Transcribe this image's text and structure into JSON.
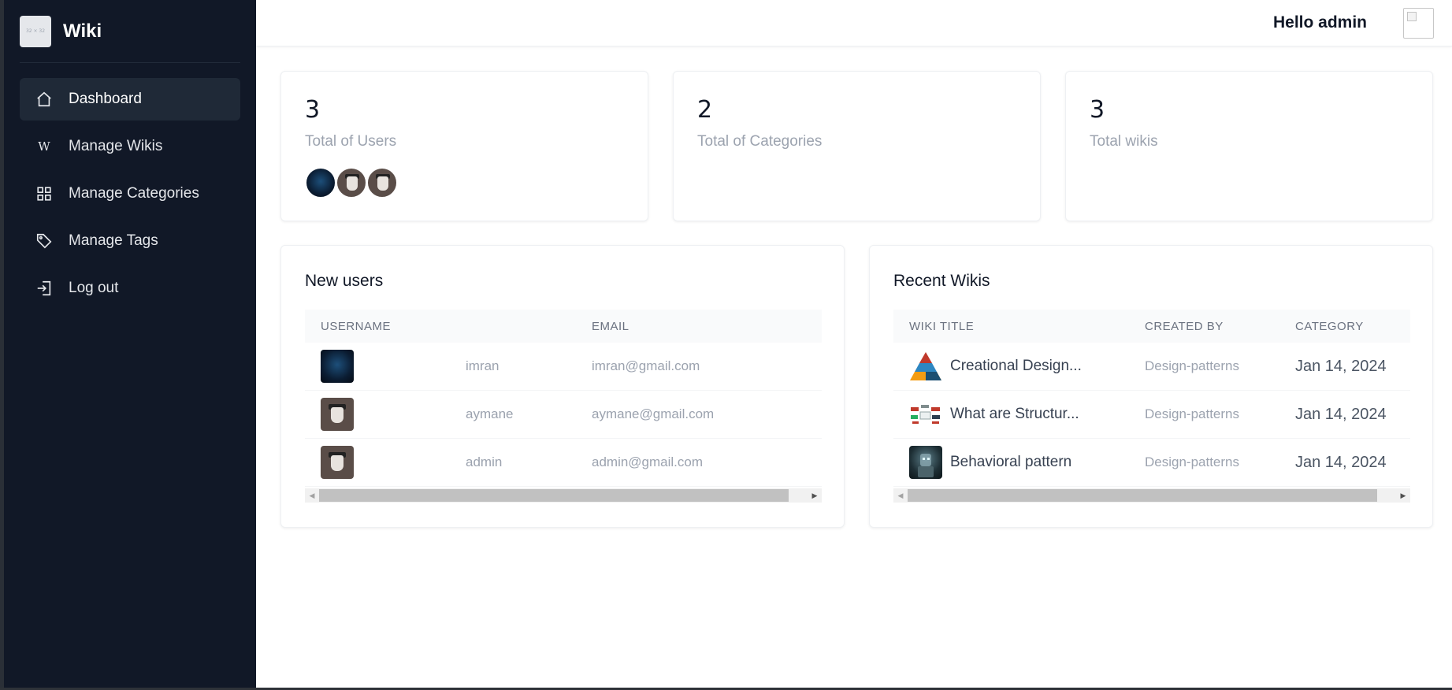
{
  "brand": {
    "logo_text": "32 × 32",
    "name": "Wiki"
  },
  "sidebar": {
    "items": [
      {
        "label": "Dashboard",
        "icon": "home-icon",
        "active": true
      },
      {
        "label": "Manage Wikis",
        "icon": "wiki-w-icon",
        "active": false
      },
      {
        "label": "Manage Categories",
        "icon": "grid-icon",
        "active": false
      },
      {
        "label": "Manage Tags",
        "icon": "tag-icon",
        "active": false
      },
      {
        "label": "Log out",
        "icon": "logout-icon",
        "active": false
      }
    ]
  },
  "header": {
    "greeting": "Hello admin",
    "avatar_icon": "broken-image-icon"
  },
  "stats": [
    {
      "value": "3",
      "label": "Total of Users"
    },
    {
      "value": "2",
      "label": "Total of Categories"
    },
    {
      "value": "3",
      "label": "Total wikis"
    }
  ],
  "new_users": {
    "title": "New users",
    "columns": [
      "USERNAME",
      "EMAIL"
    ],
    "rows": [
      {
        "username": "imran",
        "email": "imran@gmail.com",
        "avatar": "pattern-avatar"
      },
      {
        "username": "aymane",
        "email": "aymane@gmail.com",
        "avatar": "hat-avatar"
      },
      {
        "username": "admin",
        "email": "admin@gmail.com",
        "avatar": "hat-avatar"
      }
    ]
  },
  "recent_wikis": {
    "title": "Recent Wikis",
    "columns": [
      "WIKI TITLE",
      "CREATED BY",
      "CATEGORY"
    ],
    "rows": [
      {
        "title": "Creational Design...",
        "created_by": "Design-patterns",
        "category": "Jan 14, 2024",
        "thumb": "pyramid-thumbnail"
      },
      {
        "title": "What are Structur...",
        "created_by": "Design-patterns",
        "category": "Jan 14, 2024",
        "thumb": "diagram-thumbnail"
      },
      {
        "title": "Behavioral pattern",
        "created_by": "Design-patterns",
        "category": "Jan 14, 2024",
        "thumb": "robot-thumbnail"
      }
    ]
  },
  "colors": {
    "sidebar_bg": "#111827",
    "active_item_bg": "#1f2937",
    "muted_text": "#9ca3af"
  }
}
